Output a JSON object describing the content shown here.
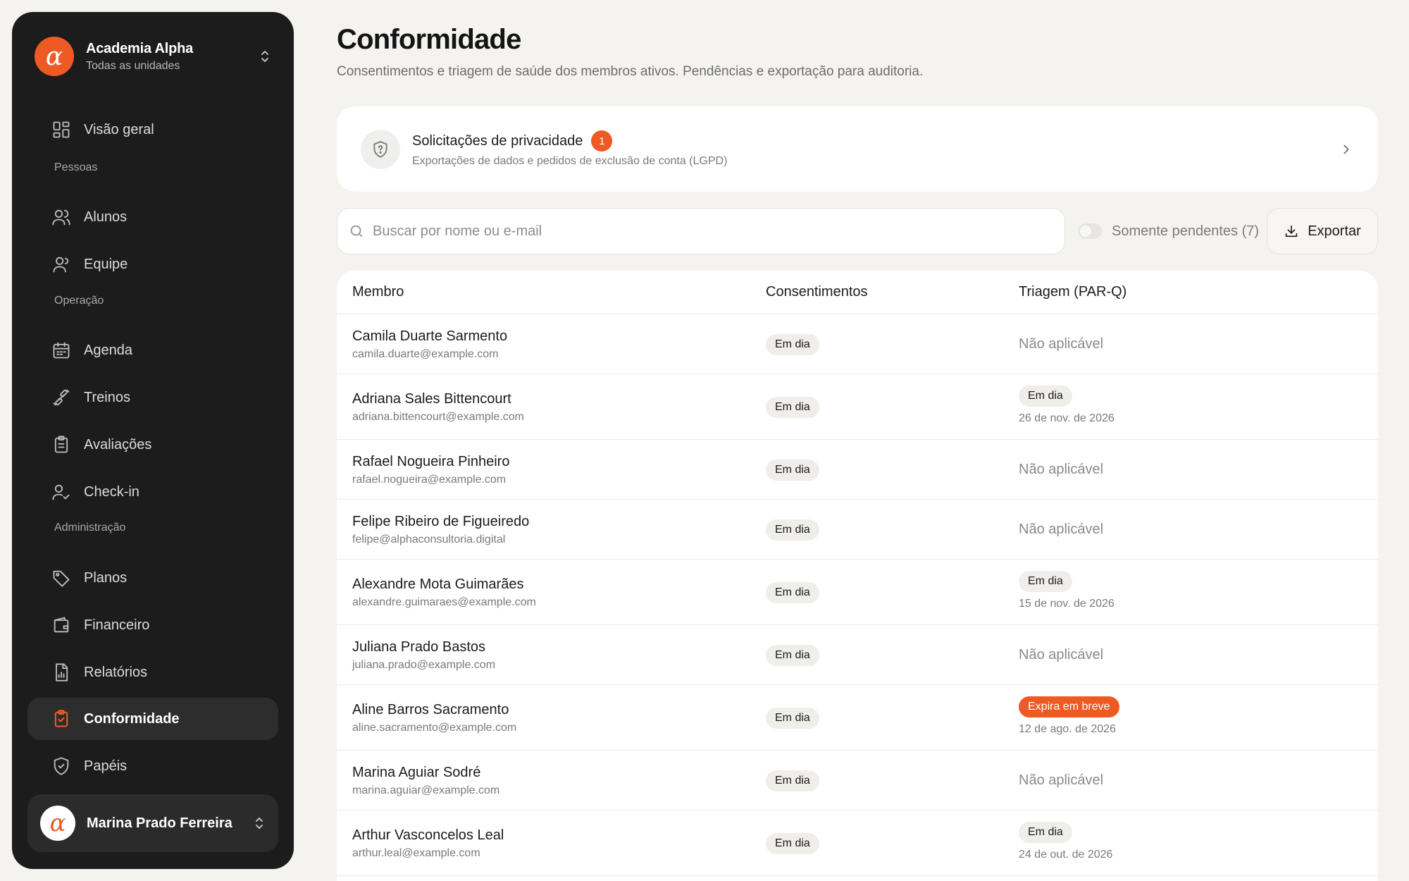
{
  "sidebar": {
    "org_name": "Academia Alpha",
    "org_sub": "Todas as unidades",
    "logo_glyph": "α",
    "overview": "Visão geral",
    "sections": {
      "people": "Pessoas",
      "operation": "Operação",
      "admin": "Administração"
    },
    "items": {
      "students": "Alunos",
      "staff": "Equipe",
      "schedule": "Agenda",
      "workouts": "Treinos",
      "assessments": "Avaliações",
      "checkin": "Check-in",
      "plans": "Planos",
      "finance": "Financeiro",
      "reports": "Relatórios",
      "compliance": "Conformidade",
      "roles": "Papéis"
    },
    "user_name": "Marina Prado Ferreira",
    "user_glyph": "α",
    "accent": "#ee5a24"
  },
  "main": {
    "title": "Conformidade",
    "subtitle": "Consentimentos e triagem de saúde dos membros ativos. Pendências e exportação para auditoria.",
    "privacy": {
      "title": "Solicitações de privacidade",
      "count": "1",
      "desc": "Exportações de dados e pedidos de exclusão de conta (LGPD)"
    },
    "search_placeholder": "Buscar por nome ou e-mail",
    "toggle_label": "Somente pendentes (7)",
    "export_label": "Exportar",
    "table": {
      "headers": {
        "member": "Membro",
        "consent": "Consentimentos",
        "triage": "Triagem (PAR-Q)"
      },
      "rows": [
        {
          "name": "Camila Duarte Sarmento",
          "email": "camila.duarte@example.com",
          "consent": "Em dia",
          "triage_text": "Não aplicável"
        },
        {
          "name": "Adriana Sales Bittencourt",
          "email": "adriana.bittencourt@example.com",
          "consent": "Em dia",
          "triage_badge": "Em dia",
          "triage_date": "26 de nov. de 2026"
        },
        {
          "name": "Rafael Nogueira Pinheiro",
          "email": "rafael.nogueira@example.com",
          "consent": "Em dia",
          "triage_text": "Não aplicável"
        },
        {
          "name": "Felipe Ribeiro de Figueiredo",
          "email": "felipe@alphaconsultoria.digital",
          "consent": "Em dia",
          "triage_text": "Não aplicável"
        },
        {
          "name": "Alexandre Mota Guimarães",
          "email": "alexandre.guimaraes@example.com",
          "consent": "Em dia",
          "triage_badge": "Em dia",
          "triage_date": "15 de nov. de 2026"
        },
        {
          "name": "Juliana Prado Bastos",
          "email": "juliana.prado@example.com",
          "consent": "Em dia",
          "triage_text": "Não aplicável"
        },
        {
          "name": "Aline Barros Sacramento",
          "email": "aline.sacramento@example.com",
          "consent": "Em dia",
          "triage_badge": "Expira em breve",
          "triage_date": "12 de ago. de 2026"
        },
        {
          "name": "Marina Aguiar Sodré",
          "email": "marina.aguiar@example.com",
          "consent": "Em dia",
          "triage_text": "Não aplicável"
        },
        {
          "name": "Arthur Vasconcelos Leal",
          "email": "arthur.leal@example.com",
          "consent": "Em dia",
          "triage_badge": "Em dia",
          "triage_date": "24 de out. de 2026"
        }
      ]
    }
  }
}
